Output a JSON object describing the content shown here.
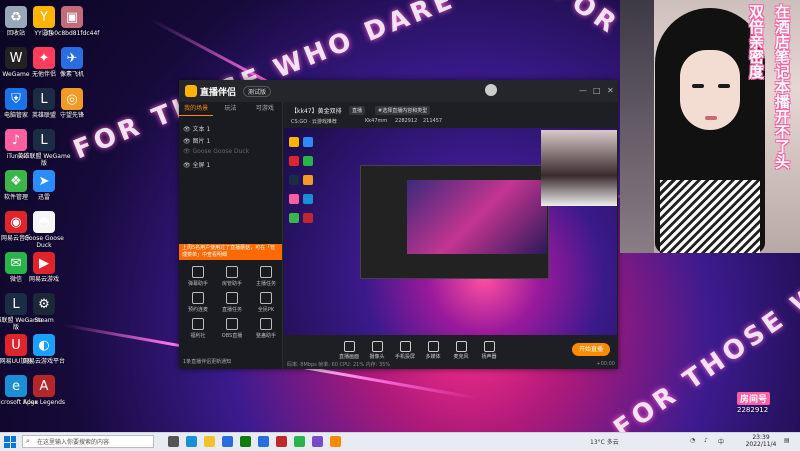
{
  "desktop": {
    "wall_text": [
      "FOR THOSE WHO DARE",
      "FOR THOSE WHO DARE",
      "FOR THOSE WHO DARE"
    ],
    "icons": [
      {
        "label": "回收站",
        "icon": "recycle-bin-icon",
        "color": "#9aa7b8",
        "glyph": "♻"
      },
      {
        "label": "YY语音",
        "icon": "yy-icon",
        "color": "#ffb400",
        "glyph": "Y"
      },
      {
        "label": "3fe0c8bd81fdc44f",
        "icon": "photo-icon",
        "color": "#c26b7a",
        "glyph": "▣"
      },
      {
        "label": "WeGame",
        "icon": "wegame-icon",
        "color": "#222",
        "glyph": "W"
      },
      {
        "label": "无他伴侣",
        "icon": "wuta-icon",
        "color": "#ff3d5a",
        "glyph": "✦"
      },
      {
        "label": "像素飞机",
        "icon": "plane-icon",
        "color": "#2a6de0",
        "glyph": "✈"
      },
      {
        "label": "电脑管家",
        "icon": "pc-manager-icon",
        "color": "#1a73e8",
        "glyph": "⛨"
      },
      {
        "label": "英雄联盟",
        "icon": "lol-icon",
        "color": "#1b2c44",
        "glyph": "L"
      },
      {
        "label": "守望先锋",
        "icon": "overwatch-icon",
        "color": "#f29b24",
        "glyph": "◎"
      },
      {
        "label": "iTunes",
        "icon": "itunes-icon",
        "color": "#ff5fa0",
        "glyph": "♪"
      },
      {
        "label": "英雄联盟 WeGame版",
        "icon": "lol-wegame-icon",
        "color": "#1b2c44",
        "glyph": "L"
      },
      {
        "label": "软件管理",
        "icon": "software-manager-icon",
        "color": "#3cb54a",
        "glyph": "❖"
      },
      {
        "label": "迅雷",
        "icon": "xunlei-icon",
        "color": "#2a8cff",
        "glyph": "➤"
      },
      {
        "label": "网易云音乐",
        "icon": "netease-music-icon",
        "color": "#e0242b",
        "glyph": "◉"
      },
      {
        "label": "Goose Goose Duck",
        "icon": "goose-icon",
        "color": "#f5f5f5",
        "glyph": "◓"
      },
      {
        "label": "微信",
        "icon": "wechat-icon",
        "color": "#2ab34a",
        "glyph": "✉"
      },
      {
        "label": "网易云游戏",
        "icon": "netease-game-icon",
        "color": "#e0242b",
        "glyph": "▶"
      },
      {
        "label": "英雄联盟 WeGame版",
        "icon": "lol-wegame2-icon",
        "color": "#1b2c44",
        "glyph": "L"
      },
      {
        "label": "Steam",
        "icon": "steam-icon",
        "color": "#1b2838",
        "glyph": "⚙"
      },
      {
        "label": "网易UU加速",
        "icon": "uu-icon",
        "color": "#e0242b",
        "glyph": "U"
      },
      {
        "label": "网易云游戏平台",
        "icon": "netease-platform-icon",
        "color": "#1aa0ff",
        "glyph": "◐"
      },
      {
        "label": "Microsoft Edge",
        "icon": "edge-icon",
        "color": "#1a8fd6",
        "glyph": "e"
      },
      {
        "label": "Apex Legends",
        "icon": "apex-icon",
        "color": "#b5262b",
        "glyph": "A"
      }
    ]
  },
  "app": {
    "logo_text": "直播伴侣",
    "version_badge": "测试版",
    "window_controls": [
      "—",
      "□",
      "✕"
    ],
    "sidebar_tabs": [
      "我的场景",
      "玩法",
      "可游戏"
    ],
    "scenes": [
      {
        "name": "文本 1",
        "dim": false
      },
      {
        "name": "图片 1",
        "dim": false
      },
      {
        "name": "Goose Goose Duck",
        "dim": true
      },
      {
        "name": "全屏 1",
        "dim": false
      }
    ],
    "notice": "上周5名用户使用过了直播蘑菇，可在「管理菜单」中查看明细",
    "tools": [
      {
        "label": "弹幕助手",
        "icon": "barrage-icon"
      },
      {
        "label": "房管助手",
        "icon": "room-admin-icon"
      },
      {
        "label": "主播任务",
        "icon": "host-task-icon"
      },
      {
        "label": "预约连麦",
        "icon": "link-mic-icon"
      },
      {
        "label": "直播任务",
        "icon": "live-task-icon"
      },
      {
        "label": "全民PK",
        "icon": "pk-icon"
      },
      {
        "label": "福利社",
        "icon": "welfare-icon"
      },
      {
        "label": "OBS直播",
        "icon": "obs-icon"
      },
      {
        "label": "整蛊助手",
        "icon": "prank-icon"
      }
    ],
    "bottom_hint": "1条直播伴侣更新通知",
    "stream_title": "【kk47】黄金双排",
    "tags": [
      "直播",
      "#选择直播内容和类型"
    ],
    "category": "CS:GO · 云游戏推荐",
    "followers": "Kk47mm",
    "room_id": "2282912",
    "viewers": "211457",
    "control_buttons": [
      {
        "label": "直播画面",
        "icon": "screen-icon"
      },
      {
        "label": "摄像头",
        "icon": "camera-icon"
      },
      {
        "label": "手机投屏",
        "icon": "phone-cast-icon"
      },
      {
        "label": "多媒体",
        "icon": "media-icon"
      },
      {
        "label": "麦克风",
        "icon": "mic-icon"
      },
      {
        "label": "扬声器",
        "icon": "speaker-icon"
      }
    ],
    "go_live_label": "开始直播",
    "stats": "码率: 8Mbps  帧率: 60  CPU: 21%  内存: 35%",
    "timer": "+00:00"
  },
  "camera": {
    "overlay_left": "双倍亲密度",
    "overlay_right": "在酒店笔记本播开不了头",
    "room_badge": "房间号",
    "room_number": "2282912"
  },
  "taskbar": {
    "search_placeholder": "在这里输入你要搜索的内容",
    "pinned": [
      {
        "icon": "task-view-icon",
        "color": "#555"
      },
      {
        "icon": "edge-taskbar-icon",
        "color": "#1a8fd6"
      },
      {
        "icon": "explorer-icon",
        "color": "#f3c12c"
      },
      {
        "icon": "store-icon",
        "color": "#2a6de0"
      },
      {
        "icon": "xbox-icon",
        "color": "#107c10"
      },
      {
        "icon": "mail-icon",
        "color": "#2a6de0"
      },
      {
        "icon": "game-icon",
        "color": "#c0282e"
      },
      {
        "icon": "wechat-taskbar-icon",
        "color": "#2ab34a"
      },
      {
        "icon": "photos-icon",
        "color": "#7a4ac8"
      },
      {
        "icon": "live-companion-icon",
        "color": "#ff8a00"
      }
    ],
    "weather": "13°C 多云",
    "time": "23:39",
    "date": "2022/11/4"
  }
}
